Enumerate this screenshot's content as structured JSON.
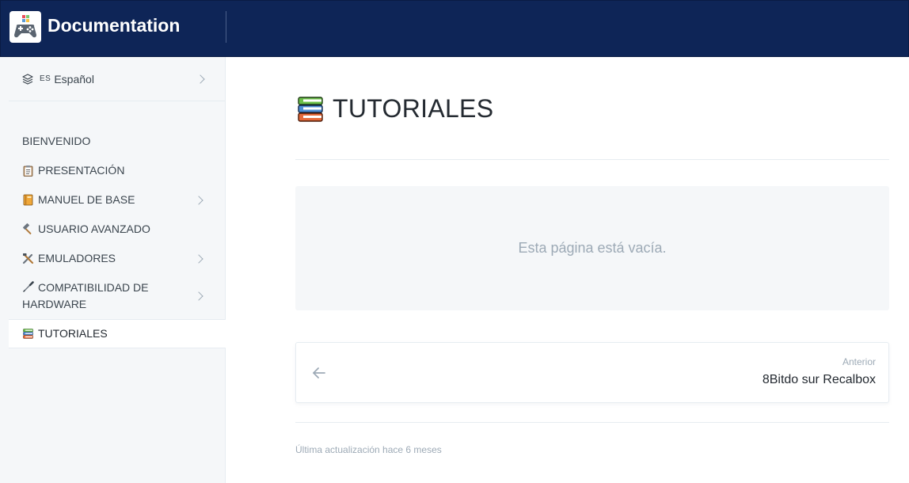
{
  "header": {
    "brand": "Documentation",
    "logo_icon": "gamepad-icon"
  },
  "sidebar": {
    "language": {
      "code": "ES",
      "name": "Español"
    },
    "items": [
      {
        "label": "BIENVENIDO",
        "icon": "",
        "expandable": false,
        "active": false
      },
      {
        "label": "PRESENTACIÓN",
        "icon": "clipboard-icon",
        "expandable": false,
        "active": false
      },
      {
        "label": "MANUEL DE BASE",
        "icon": "book-icon",
        "expandable": true,
        "active": false
      },
      {
        "label": "USUARIO AVANZADO",
        "icon": "hammer-icon",
        "expandable": false,
        "active": false
      },
      {
        "label": "EMULADORES",
        "icon": "tools-icon",
        "expandable": true,
        "active": false
      },
      {
        "label": "COMPATIBILIDAD DE HARDWARE",
        "icon": "screwdriver-icon",
        "expandable": true,
        "active": false
      },
      {
        "label": "TUTORIALES",
        "icon": "books-icon",
        "expandable": false,
        "active": true
      }
    ]
  },
  "main": {
    "title": "TUTORIALES",
    "title_icon": "books-icon",
    "empty_message": "Esta página está vacía.",
    "previous": {
      "label": "Anterior",
      "title": "8Bitdo sur Recalbox"
    },
    "last_updated": "Última actualización hace 6 meses"
  },
  "colors": {
    "header_bg": "#0e2557",
    "sidebar_bg": "#f5f7f9",
    "muted_text": "#9daab6"
  }
}
